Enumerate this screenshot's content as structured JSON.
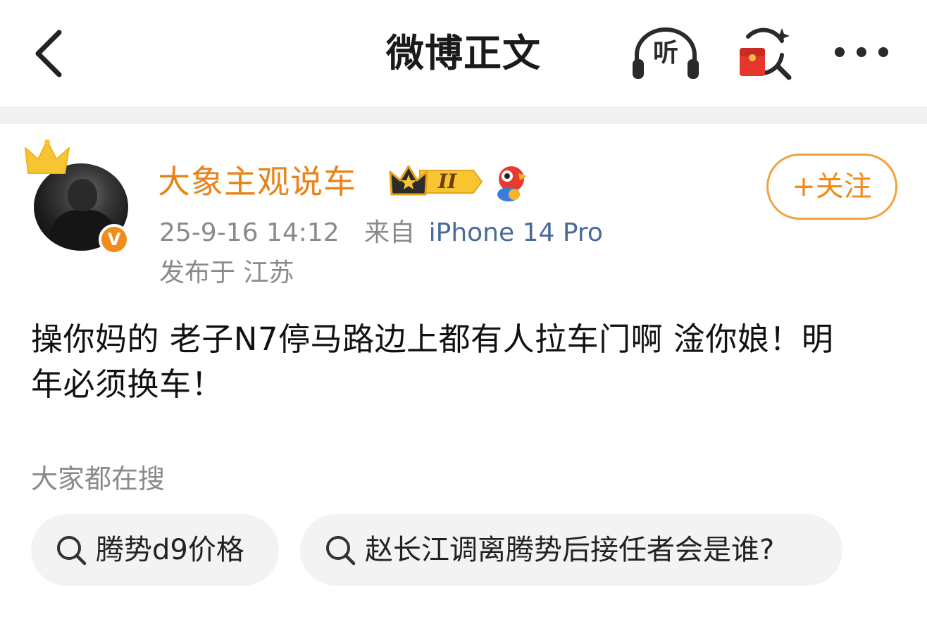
{
  "nav": {
    "title": "微博正文",
    "listen_label": "听"
  },
  "author": {
    "name": "大象主观说车",
    "verified_mark": "V",
    "vip_level": "II",
    "follow_label": "+关注"
  },
  "post": {
    "timestamp": "25-9-16 14:12",
    "source_prefix": "来自",
    "source_device": "iPhone 14 Pro",
    "location": "发布于 江苏",
    "text": "操你妈的 老子N7停马路边上都有人拉车门啊 淦你娘！明年必须换车！"
  },
  "trending": {
    "heading": "大家都在搜",
    "items": [
      {
        "label": "腾势d9价格",
        "icon": "search-icon"
      },
      {
        "label": "赵长江调离腾势后接任者会是谁?",
        "icon": "search-icon"
      }
    ]
  },
  "colors": {
    "accent": "#f08c1a",
    "username": "#e8831a",
    "follow_border": "#f4a13d",
    "meta_text": "#8a8a8a",
    "device_link": "#4a6a9a",
    "pill_bg": "#f3f3f3"
  }
}
